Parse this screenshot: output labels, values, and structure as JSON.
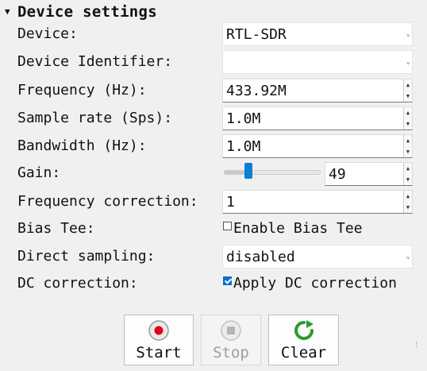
{
  "section": {
    "title": "Device settings"
  },
  "rows": {
    "device": {
      "label": "Device:",
      "value": "RTL-SDR"
    },
    "device_identifier": {
      "label": "Device Identifier:",
      "value": ""
    },
    "frequency": {
      "label": "Frequency (Hz):",
      "value": "433.92M"
    },
    "sample_rate": {
      "label": "Sample rate (Sps):",
      "value": "1.0M"
    },
    "bandwidth": {
      "label": "Bandwidth (Hz):",
      "value": "1.0M"
    },
    "gain": {
      "label": "Gain:",
      "value": "49",
      "slider_fraction": 0.24
    },
    "frequency_correction": {
      "label": "Frequency correction:",
      "value": "1"
    },
    "bias_tee": {
      "label": "Bias Tee:",
      "checkbox_label": "Enable Bias Tee",
      "checked": false
    },
    "direct_sampling": {
      "label": "Direct sampling:",
      "value": "disabled"
    },
    "dc_correction": {
      "label": "DC correction:",
      "checkbox_label": "Apply DC correction",
      "checked": true
    }
  },
  "buttons": {
    "start": {
      "label": "Start",
      "icon": "record-icon"
    },
    "stop": {
      "label": "Stop",
      "icon": "stop-icon",
      "disabled": true
    },
    "clear": {
      "label": "Clear",
      "icon": "refresh-icon"
    }
  },
  "colors": {
    "accent": "#0a7fd4",
    "start_red": "#e0001a",
    "clear_green": "#2a9d2a"
  }
}
